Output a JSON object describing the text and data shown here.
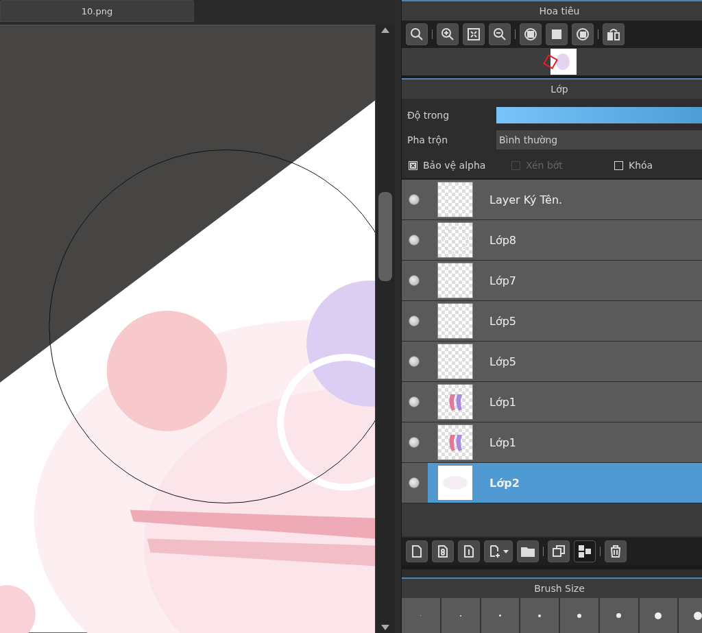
{
  "document_tab": {
    "title": "10.png",
    "selected": true
  },
  "navigator": {
    "title": "Hoa tiêu"
  },
  "layers_panel": {
    "title": "Lớp",
    "opacity": {
      "label": "Độ trong",
      "level": 1
    },
    "blend": {
      "label": "Pha trộn",
      "value": "Bình thường"
    },
    "options": [
      {
        "label": "Bảo vệ alpha",
        "checked": true,
        "disabled": false
      },
      {
        "label": "Xén bớt",
        "checked": false,
        "disabled": true
      },
      {
        "label": "Khóa",
        "checked": false,
        "disabled": false
      }
    ],
    "layers": [
      {
        "name": "Layer Ký Tên.",
        "visible": true,
        "selected": false,
        "kind": "empty"
      },
      {
        "name": "Lớp8",
        "visible": true,
        "selected": false,
        "kind": "dots"
      },
      {
        "name": "Lớp7",
        "visible": true,
        "selected": false,
        "kind": "empty"
      },
      {
        "name": "Lớp5",
        "visible": true,
        "selected": false,
        "kind": "empty"
      },
      {
        "name": "Lớp5",
        "visible": true,
        "selected": false,
        "kind": "empty"
      },
      {
        "name": "Lớp1",
        "visible": true,
        "selected": false,
        "kind": "strokes"
      },
      {
        "name": "Lớp1",
        "visible": true,
        "selected": false,
        "kind": "strokes"
      },
      {
        "name": "Lớp2",
        "visible": true,
        "selected": true,
        "kind": "white"
      }
    ]
  },
  "brush_size": {
    "title": "Brush Size"
  }
}
